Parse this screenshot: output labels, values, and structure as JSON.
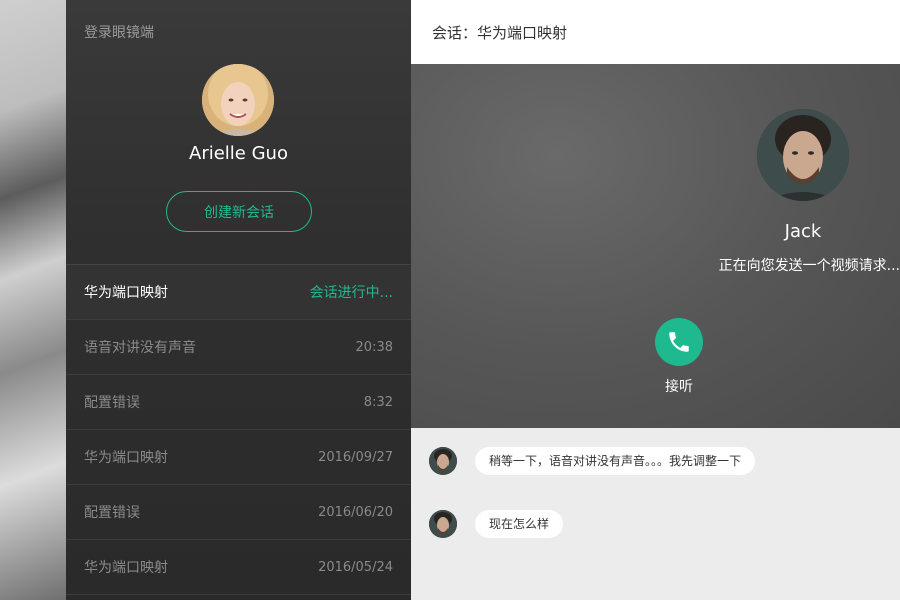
{
  "left_panel": {
    "login_title": "登录眼镜端",
    "profile_name": "Arielle Guo",
    "new_session_label": "创建新会话",
    "sessions": [
      {
        "name": "华为端口映射",
        "time": "会话进行中..."
      },
      {
        "name": "语音对讲没有声音",
        "time": "20:38"
      },
      {
        "name": "配置错误",
        "time": "8:32"
      },
      {
        "name": "华为端口映射",
        "time": "2016/09/27"
      },
      {
        "name": "配置错误",
        "time": "2016/06/20"
      },
      {
        "name": "华为端口映射",
        "time": "2016/05/24"
      }
    ]
  },
  "right_panel": {
    "header_title": "会话：华为端口映射",
    "caller_name": "Jack",
    "caller_status": "正在向您发送一个视频请求...",
    "answer_label": "接听",
    "messages": [
      {
        "text": "稍等一下，语音对讲没有声音。。。我先调整一下"
      },
      {
        "text": "现在怎么样"
      }
    ]
  },
  "colors": {
    "accent": "#1fb990",
    "panel_dark": "#2f2f2f",
    "call_bg": "#575757",
    "chat_bg": "#ececec"
  },
  "icons": {
    "answer": "phone-icon"
  }
}
